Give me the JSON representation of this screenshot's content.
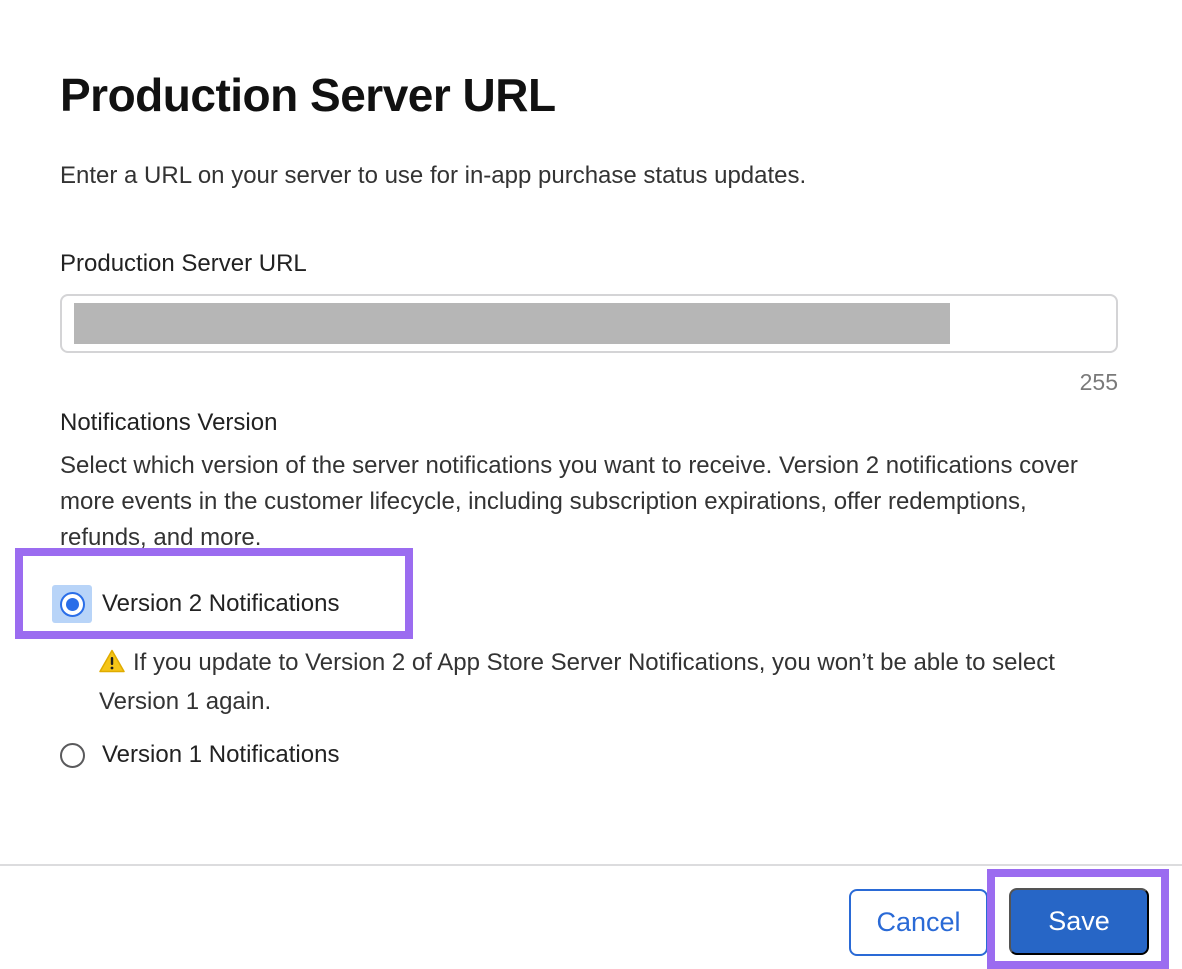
{
  "dialog": {
    "title": "Production Server URL",
    "description": "Enter a URL on your server to use for in-app purchase status updates."
  },
  "url_field": {
    "label": "Production Server URL",
    "char_count": "255"
  },
  "notifications": {
    "section_label": "Notifications Version",
    "section_description": "Select which version of the server notifications you want to receive. Version 2 notifications cover more events in the customer lifecycle, including subscription expirations, offer redemptions, refunds, and more.",
    "option_v2_label": "Version 2 Notifications",
    "option_v2_selected": true,
    "warning_icon": "warning-triangle-icon",
    "warning_text": "If you update to Version 2 of App Store Server Notifications, you won’t be able to select Version 1 again.",
    "option_v1_label": "Version 1 Notifications",
    "option_v1_selected": false
  },
  "footer": {
    "cancel_label": "Cancel",
    "save_label": "Save"
  },
  "colors": {
    "accent": "#2766c6",
    "highlight": "#9b6cf0",
    "warning": "#f5c518"
  }
}
